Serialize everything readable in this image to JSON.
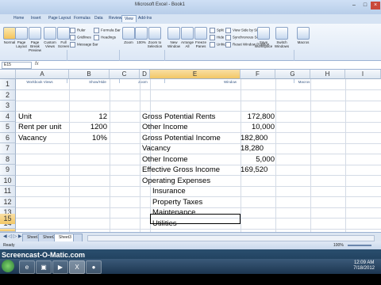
{
  "window": {
    "title": "Microsoft Excel - Book1",
    "minimize": "–",
    "maximize": "□",
    "close": "×"
  },
  "ribbon": {
    "tabs": [
      "Home",
      "Insert",
      "Page Layout",
      "Formulas",
      "Data",
      "Review",
      "View",
      "Add-Ins"
    ],
    "active_tab": "View",
    "buttons": {
      "normal": "Normal",
      "page_layout": "Page Layout",
      "page_break": "Page Break Preview",
      "custom_views": "Custom Views",
      "full_screen": "Full Screen",
      "zoom": "Zoom",
      "zoom100": "100%",
      "zoom_selection": "Zoom to Selection",
      "new_window": "New Window",
      "arrange_all": "Arrange All",
      "freeze_panes": "Freeze Panes",
      "save_workspace": "Save Workspace",
      "switch_windows": "Switch Windows",
      "macros": "Macros"
    },
    "checks": {
      "ruler": "Ruler",
      "gridlines": "Gridlines",
      "message_bar": "Message Bar",
      "formula_bar": "Formula Bar",
      "headings": "Headings",
      "split": "Split",
      "hide": "Hide",
      "unhide": "Unhide",
      "side_by_side": "View Side by Side",
      "sync_scroll": "Synchronous Scrolling",
      "reset_pos": "Reset Window Position"
    },
    "groups": {
      "workbook_views": "Workbook Views",
      "show_hide": "Show/Hide",
      "zoom_group": "Zoom",
      "window": "Window",
      "macros_group": "Macros"
    }
  },
  "formula_bar": {
    "name_box": "E15",
    "fx": "fx"
  },
  "columns": [
    "A",
    "B",
    "C",
    "D",
    "E",
    "F",
    "G",
    "H",
    "I"
  ],
  "rows": [
    "1",
    "2",
    "3",
    "4",
    "5",
    "6",
    "7",
    "8",
    "9",
    "10",
    "11",
    "12",
    "13",
    "14",
    "15"
  ],
  "cells": {
    "a4": "Unit",
    "b4": "12",
    "a5": "Rent per unit",
    "b5": "1200",
    "a6": "Vacancy",
    "b6": "10%",
    "e4": "Gross Potential Rents",
    "f4": "172,800",
    "e5": "Other Income",
    "f5": "10,000",
    "e6": "Gross Potential Income",
    "f6": "182,800",
    "e7": "Vacancy",
    "f7": "18,280",
    "e8": "Other Income",
    "f8": "5,000",
    "e9": "Effective Gross Income",
    "f9": "169,520",
    "e10": "Operating Expenses",
    "e11": "Insurance",
    "e12": "Property Taxes",
    "e13": "Maintenance",
    "e14": "Utilities"
  },
  "sheets": [
    "Sheet1",
    "Sheet2",
    "Sheet3"
  ],
  "active_sheet": "Sheet3",
  "status": {
    "ready": "Ready",
    "zoom": "100%"
  },
  "taskbar": {
    "time": "12:09 AM",
    "date": "7/18/2012"
  },
  "watermark": "Screencast-O-Matic.com"
}
